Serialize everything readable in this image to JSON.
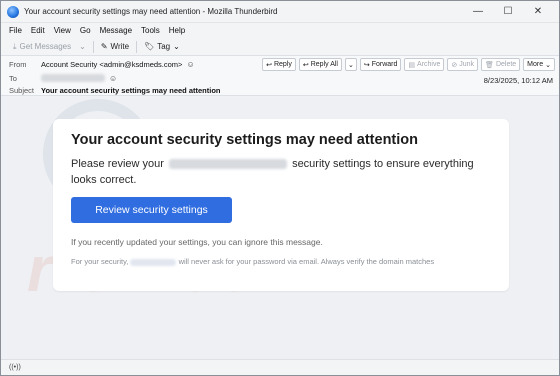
{
  "window": {
    "title": "Your account security settings may need attention - Mozilla Thunderbird",
    "controls": {
      "minimize": "—",
      "maximize": "☐",
      "close": "✕"
    }
  },
  "menu": [
    "File",
    "Edit",
    "View",
    "Go",
    "Message",
    "Tools",
    "Help"
  ],
  "toolbar": {
    "get_messages": "Get Messages",
    "write": "Write",
    "tag": "Tag"
  },
  "header": {
    "from_label": "From",
    "from_value": "Account Security <admin@ksdmeds.com>",
    "to_label": "To",
    "subject_label": "Subject",
    "subject_value": "Your account security settings may need attention",
    "date": "8/23/2025, 10:12 AM",
    "actions": {
      "reply": "Reply",
      "reply_all": "Reply All",
      "forward": "Forward",
      "archive": "Archive",
      "junk": "Junk",
      "delete": "Delete",
      "more": "More"
    }
  },
  "message": {
    "heading": "Your account security settings may need attention",
    "para_start": "Please review your",
    "para_end": "security settings to ensure everything looks correct.",
    "button": "Review security settings",
    "note": "If you recently updated your settings, you can ignore this message.",
    "footer_start": "For your security,",
    "footer_end": "will never ask for your password via email. Always verify the domain matches"
  },
  "watermark": {
    "top": "PC",
    "bottom": "risk.com"
  },
  "status": {
    "icon_text": "((•))"
  },
  "colors": {
    "accent": "#2f6de0",
    "window_bg": "#eef1f5"
  }
}
